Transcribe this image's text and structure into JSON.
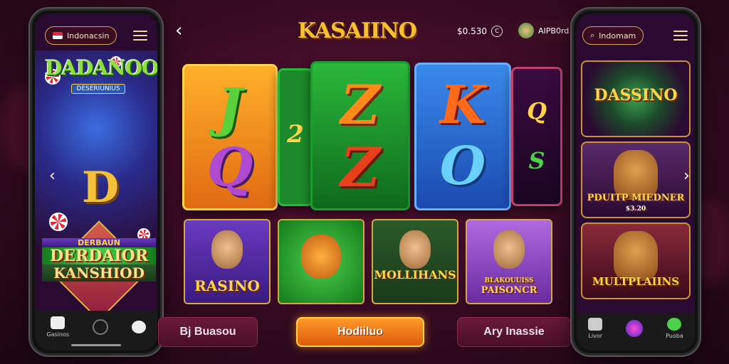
{
  "left_phone": {
    "region_pill": "Indonacsin",
    "logo_title": "DADANOO",
    "logo_subtitle": "DESERIUNIUS",
    "big_letter": "D",
    "promo_line1": "DERBAUN",
    "promo_line2": "DERDAIOR",
    "promo_line3": "KANSHIOD",
    "nav": [
      {
        "label": "Gasinos",
        "icon": "wallet-icon"
      },
      {
        "label": "",
        "icon": "home-circle-icon"
      },
      {
        "label": "",
        "icon": "chat-icon"
      }
    ]
  },
  "header": {
    "brand": "KASAIINO",
    "balance": "$0.530",
    "coin_glyph": "C",
    "user_label": "AIPB0rd"
  },
  "reels": {
    "orange": [
      "J",
      "Q"
    ],
    "green_side": "2",
    "green_main": [
      "Z",
      "Z"
    ],
    "blue": [
      "K",
      "O"
    ],
    "dark": [
      "Q",
      "S"
    ]
  },
  "thumbs": [
    {
      "label": "RASINO"
    },
    {
      "label": ""
    },
    {
      "label": "MOLLIHANS"
    },
    {
      "label": "PAISONCR",
      "sub": "BLAKOUUISS"
    }
  ],
  "buttons": {
    "left": "Bj Buasou",
    "main": "Hodiiluo",
    "right": "Ary Inassie"
  },
  "right_phone": {
    "region_pill": "Indomam",
    "tiles": [
      {
        "label": "DASSINO"
      },
      {
        "label": "PDUITP MIEDNER",
        "sub": "$3.20"
      },
      {
        "label": "MULTPLAIINS"
      }
    ],
    "nav": [
      {
        "label": "Livor",
        "icon": "tools-icon"
      },
      {
        "label": "",
        "icon": "spin-icon"
      },
      {
        "label": "Puoba",
        "icon": "gift-icon"
      }
    ]
  },
  "colors": {
    "gold": "#ffd44a",
    "bg": "#3a0b24",
    "accent": "#ff9a2a"
  }
}
